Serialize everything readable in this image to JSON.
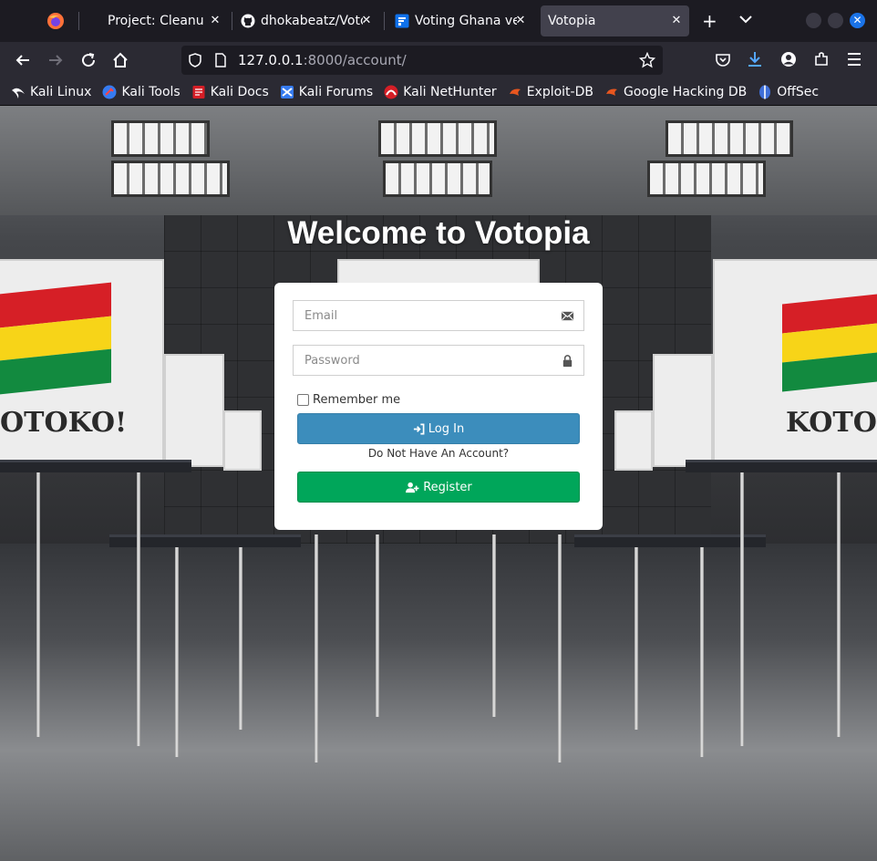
{
  "browser": {
    "tabs": [
      {
        "title": "Project: Cleanup",
        "icon": "project-tab-icon"
      },
      {
        "title": "dhokabeatz/Voto",
        "icon": "github-icon"
      },
      {
        "title": "Voting Ghana ve",
        "icon": "form-icon"
      },
      {
        "title": "Votopia",
        "icon": ""
      }
    ],
    "active_tab": 3,
    "url_host": "127.0.0.1",
    "url_path": ":8000/account/",
    "bookmarks": [
      {
        "label": "Kali Linux",
        "icon": "kali-dragon-icon"
      },
      {
        "label": "Kali Tools",
        "icon": "kali-tools-icon"
      },
      {
        "label": "Kali Docs",
        "icon": "kali-docs-icon"
      },
      {
        "label": "Kali Forums",
        "icon": "kali-forums-icon"
      },
      {
        "label": "Kali NetHunter",
        "icon": "nethunter-icon"
      },
      {
        "label": "Exploit-DB",
        "icon": "exploit-db-icon"
      },
      {
        "label": "Google Hacking DB",
        "icon": "ghdb-icon"
      },
      {
        "label": "OffSec",
        "icon": "offsec-icon"
      }
    ]
  },
  "page": {
    "heading": "Welcome to Votopia",
    "background_signs": [
      "OTOKO!",
      "KOTOK"
    ],
    "form": {
      "email_placeholder": "Email",
      "password_placeholder": "Password",
      "remember_label": "Remember me",
      "login_label": "Log In",
      "no_account_text": "Do Not Have An Account?",
      "register_label": "Register"
    }
  },
  "colors": {
    "login_button": "#3c8dbc",
    "register_button": "#00a65a",
    "browser_chrome": "#2b2a33",
    "flag_red": "#d61f26",
    "flag_yellow": "#f7d418",
    "flag_green": "#128a3f"
  }
}
